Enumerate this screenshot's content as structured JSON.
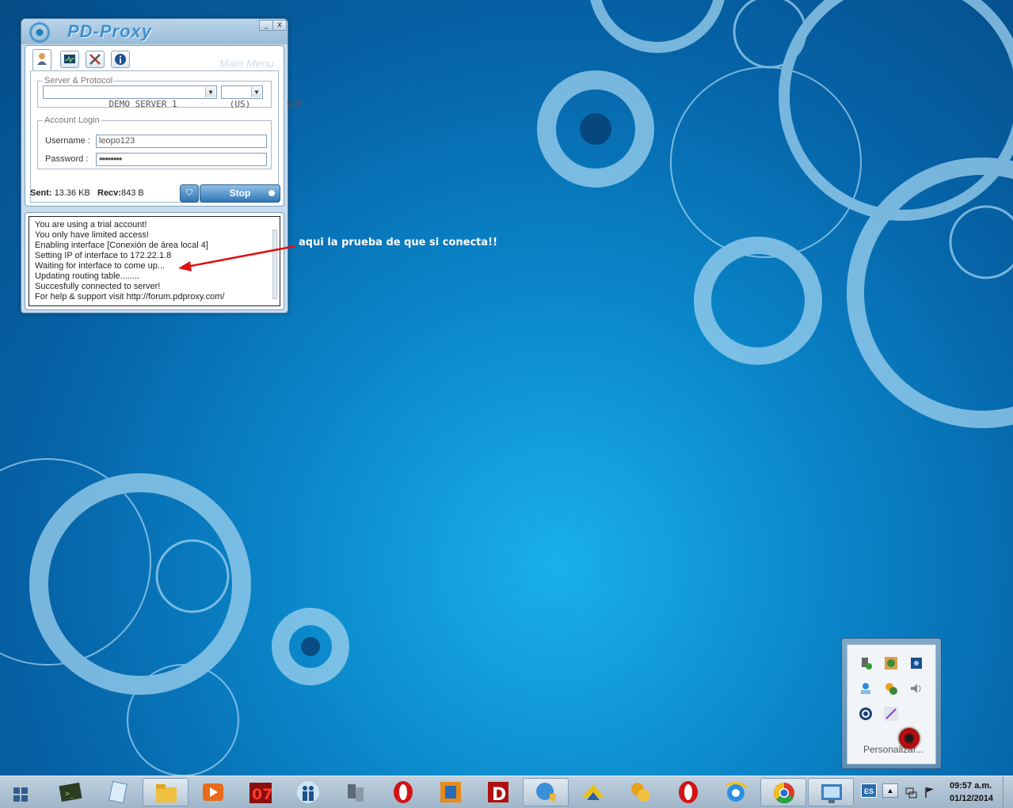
{
  "pdproxy": {
    "title": "PD-Proxy",
    "minimize": "_",
    "close": "x",
    "tabs": [
      "account-tab",
      "monitor-tab",
      "tools-tab",
      "info-tab"
    ],
    "menu_label": "Main Menu",
    "server_group": "Server & Protocol",
    "server_value": "DEMO SERVER 1          (US)",
    "protocol_value": "UDP",
    "account_group": "Account Login",
    "username_label": "Username :",
    "username_value": "leopo123",
    "password_label": "Password :",
    "password_value": "••••••••",
    "sent_label": "Sent:",
    "sent_value": "13.36 KB",
    "recv_label": "Recv:",
    "recv_value": "843 B",
    "stop_label": "Stop",
    "log": [
      "You are using a trial account!",
      "You only have limited access!",
      "Enabling interface [Conexión de área local 4]",
      "Setting IP of interface to 172.22.1.8",
      "Waiting for interface to come up...",
      "Updating routing table........",
      "Succesfully connected to server!",
      "For help & support visit http://forum.pdproxy.com/"
    ]
  },
  "annotation": "aqui la prueba de que si conecta!!",
  "tray": {
    "customize": "Personalizar..."
  },
  "taskbar": {
    "language": "ES",
    "time": "09:57 a.m.",
    "date": "01/12/2014",
    "apps": [
      "start",
      "terminal",
      "notepad",
      "explorer",
      "media",
      "ares-07",
      "people",
      "network-tool",
      "opera",
      "installer",
      "dtool",
      "network-globe",
      "arrow-tool",
      "utility",
      "opera",
      "internet-explorer",
      "chrome",
      "control-panel"
    ]
  },
  "colors": {
    "desktop": "#0a86c9",
    "accent": "#3f8fcf",
    "annotation_arrow": "#e01010"
  }
}
